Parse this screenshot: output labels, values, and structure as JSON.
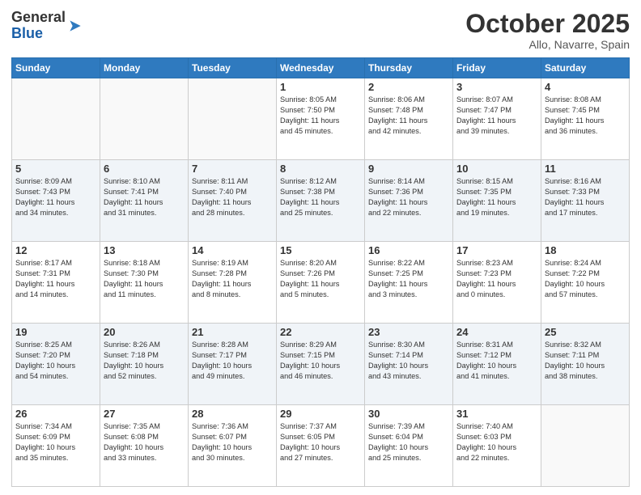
{
  "header": {
    "logo_general": "General",
    "logo_blue": "Blue",
    "month_title": "October 2025",
    "location": "Allo, Navarre, Spain"
  },
  "weekdays": [
    "Sunday",
    "Monday",
    "Tuesday",
    "Wednesday",
    "Thursday",
    "Friday",
    "Saturday"
  ],
  "weeks": [
    [
      {
        "day": "",
        "info": ""
      },
      {
        "day": "",
        "info": ""
      },
      {
        "day": "",
        "info": ""
      },
      {
        "day": "1",
        "info": "Sunrise: 8:05 AM\nSunset: 7:50 PM\nDaylight: 11 hours\nand 45 minutes."
      },
      {
        "day": "2",
        "info": "Sunrise: 8:06 AM\nSunset: 7:48 PM\nDaylight: 11 hours\nand 42 minutes."
      },
      {
        "day": "3",
        "info": "Sunrise: 8:07 AM\nSunset: 7:47 PM\nDaylight: 11 hours\nand 39 minutes."
      },
      {
        "day": "4",
        "info": "Sunrise: 8:08 AM\nSunset: 7:45 PM\nDaylight: 11 hours\nand 36 minutes."
      }
    ],
    [
      {
        "day": "5",
        "info": "Sunrise: 8:09 AM\nSunset: 7:43 PM\nDaylight: 11 hours\nand 34 minutes."
      },
      {
        "day": "6",
        "info": "Sunrise: 8:10 AM\nSunset: 7:41 PM\nDaylight: 11 hours\nand 31 minutes."
      },
      {
        "day": "7",
        "info": "Sunrise: 8:11 AM\nSunset: 7:40 PM\nDaylight: 11 hours\nand 28 minutes."
      },
      {
        "day": "8",
        "info": "Sunrise: 8:12 AM\nSunset: 7:38 PM\nDaylight: 11 hours\nand 25 minutes."
      },
      {
        "day": "9",
        "info": "Sunrise: 8:14 AM\nSunset: 7:36 PM\nDaylight: 11 hours\nand 22 minutes."
      },
      {
        "day": "10",
        "info": "Sunrise: 8:15 AM\nSunset: 7:35 PM\nDaylight: 11 hours\nand 19 minutes."
      },
      {
        "day": "11",
        "info": "Sunrise: 8:16 AM\nSunset: 7:33 PM\nDaylight: 11 hours\nand 17 minutes."
      }
    ],
    [
      {
        "day": "12",
        "info": "Sunrise: 8:17 AM\nSunset: 7:31 PM\nDaylight: 11 hours\nand 14 minutes."
      },
      {
        "day": "13",
        "info": "Sunrise: 8:18 AM\nSunset: 7:30 PM\nDaylight: 11 hours\nand 11 minutes."
      },
      {
        "day": "14",
        "info": "Sunrise: 8:19 AM\nSunset: 7:28 PM\nDaylight: 11 hours\nand 8 minutes."
      },
      {
        "day": "15",
        "info": "Sunrise: 8:20 AM\nSunset: 7:26 PM\nDaylight: 11 hours\nand 5 minutes."
      },
      {
        "day": "16",
        "info": "Sunrise: 8:22 AM\nSunset: 7:25 PM\nDaylight: 11 hours\nand 3 minutes."
      },
      {
        "day": "17",
        "info": "Sunrise: 8:23 AM\nSunset: 7:23 PM\nDaylight: 11 hours\nand 0 minutes."
      },
      {
        "day": "18",
        "info": "Sunrise: 8:24 AM\nSunset: 7:22 PM\nDaylight: 10 hours\nand 57 minutes."
      }
    ],
    [
      {
        "day": "19",
        "info": "Sunrise: 8:25 AM\nSunset: 7:20 PM\nDaylight: 10 hours\nand 54 minutes."
      },
      {
        "day": "20",
        "info": "Sunrise: 8:26 AM\nSunset: 7:18 PM\nDaylight: 10 hours\nand 52 minutes."
      },
      {
        "day": "21",
        "info": "Sunrise: 8:28 AM\nSunset: 7:17 PM\nDaylight: 10 hours\nand 49 minutes."
      },
      {
        "day": "22",
        "info": "Sunrise: 8:29 AM\nSunset: 7:15 PM\nDaylight: 10 hours\nand 46 minutes."
      },
      {
        "day": "23",
        "info": "Sunrise: 8:30 AM\nSunset: 7:14 PM\nDaylight: 10 hours\nand 43 minutes."
      },
      {
        "day": "24",
        "info": "Sunrise: 8:31 AM\nSunset: 7:12 PM\nDaylight: 10 hours\nand 41 minutes."
      },
      {
        "day": "25",
        "info": "Sunrise: 8:32 AM\nSunset: 7:11 PM\nDaylight: 10 hours\nand 38 minutes."
      }
    ],
    [
      {
        "day": "26",
        "info": "Sunrise: 7:34 AM\nSunset: 6:09 PM\nDaylight: 10 hours\nand 35 minutes."
      },
      {
        "day": "27",
        "info": "Sunrise: 7:35 AM\nSunset: 6:08 PM\nDaylight: 10 hours\nand 33 minutes."
      },
      {
        "day": "28",
        "info": "Sunrise: 7:36 AM\nSunset: 6:07 PM\nDaylight: 10 hours\nand 30 minutes."
      },
      {
        "day": "29",
        "info": "Sunrise: 7:37 AM\nSunset: 6:05 PM\nDaylight: 10 hours\nand 27 minutes."
      },
      {
        "day": "30",
        "info": "Sunrise: 7:39 AM\nSunset: 6:04 PM\nDaylight: 10 hours\nand 25 minutes."
      },
      {
        "day": "31",
        "info": "Sunrise: 7:40 AM\nSunset: 6:03 PM\nDaylight: 10 hours\nand 22 minutes."
      },
      {
        "day": "",
        "info": ""
      }
    ]
  ]
}
